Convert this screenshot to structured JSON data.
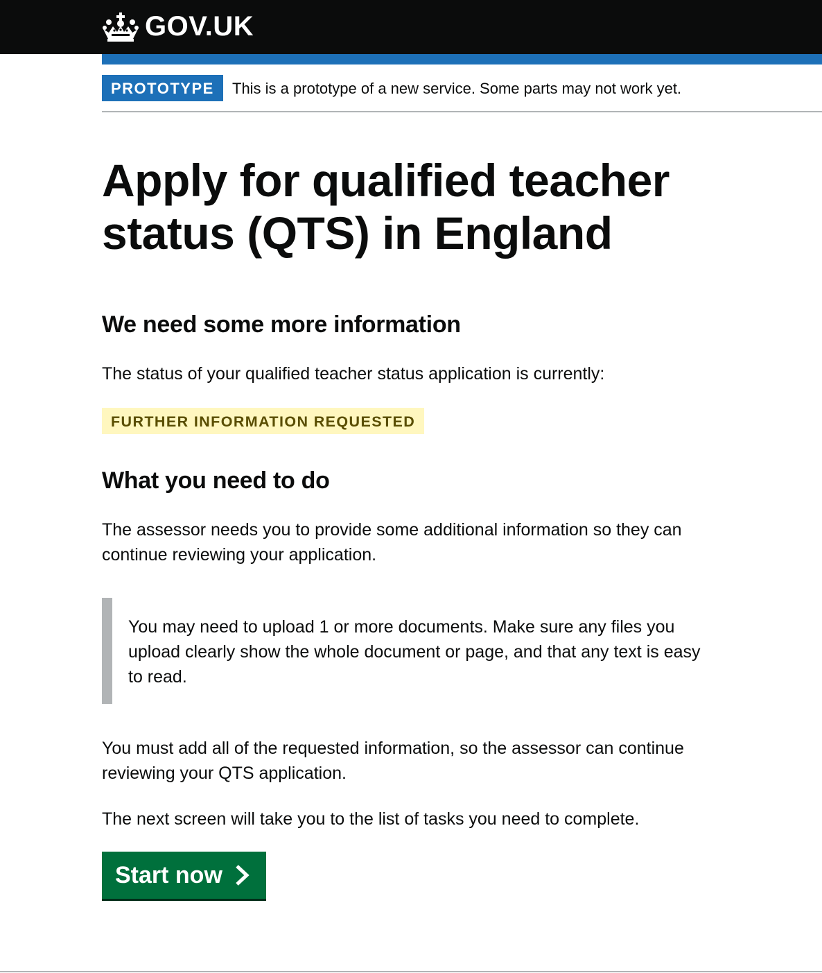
{
  "header": {
    "logo_text": "GOV.UK"
  },
  "phase_banner": {
    "tag": "PROTOTYPE",
    "text": "This is a prototype of a new service. Some parts may not work yet."
  },
  "main": {
    "title": "Apply for qualified teacher status (QTS) in England",
    "heading_more_info": "We need some more information",
    "status_intro": "The status of your qualified teacher status application is currently:",
    "status_tag": "FURTHER INFORMATION REQUESTED",
    "heading_what_to_do": "What you need to do",
    "assessor_text": "The assessor needs you to provide some additional information so they can continue reviewing your application.",
    "inset_text": "You may need to upload 1 or more documents. Make sure any files you upload clearly show the whole document or page, and that any text is easy to read.",
    "must_add_text": "You must add all of the requested information, so the assessor can continue reviewing your QTS application.",
    "next_screen_text": "The next screen will take you to the list of tasks you need to complete.",
    "start_button_label": "Start now"
  },
  "colors": {
    "header_background": "#0b0c0c",
    "brand_blue": "#1d70b8",
    "button_green": "#00703c",
    "status_tag_background": "#fff7bf",
    "status_tag_text": "#594d00",
    "inset_border": "#b1b4b6"
  },
  "icons": {
    "logo": "crown-icon",
    "button": "chevron-right-icon"
  }
}
